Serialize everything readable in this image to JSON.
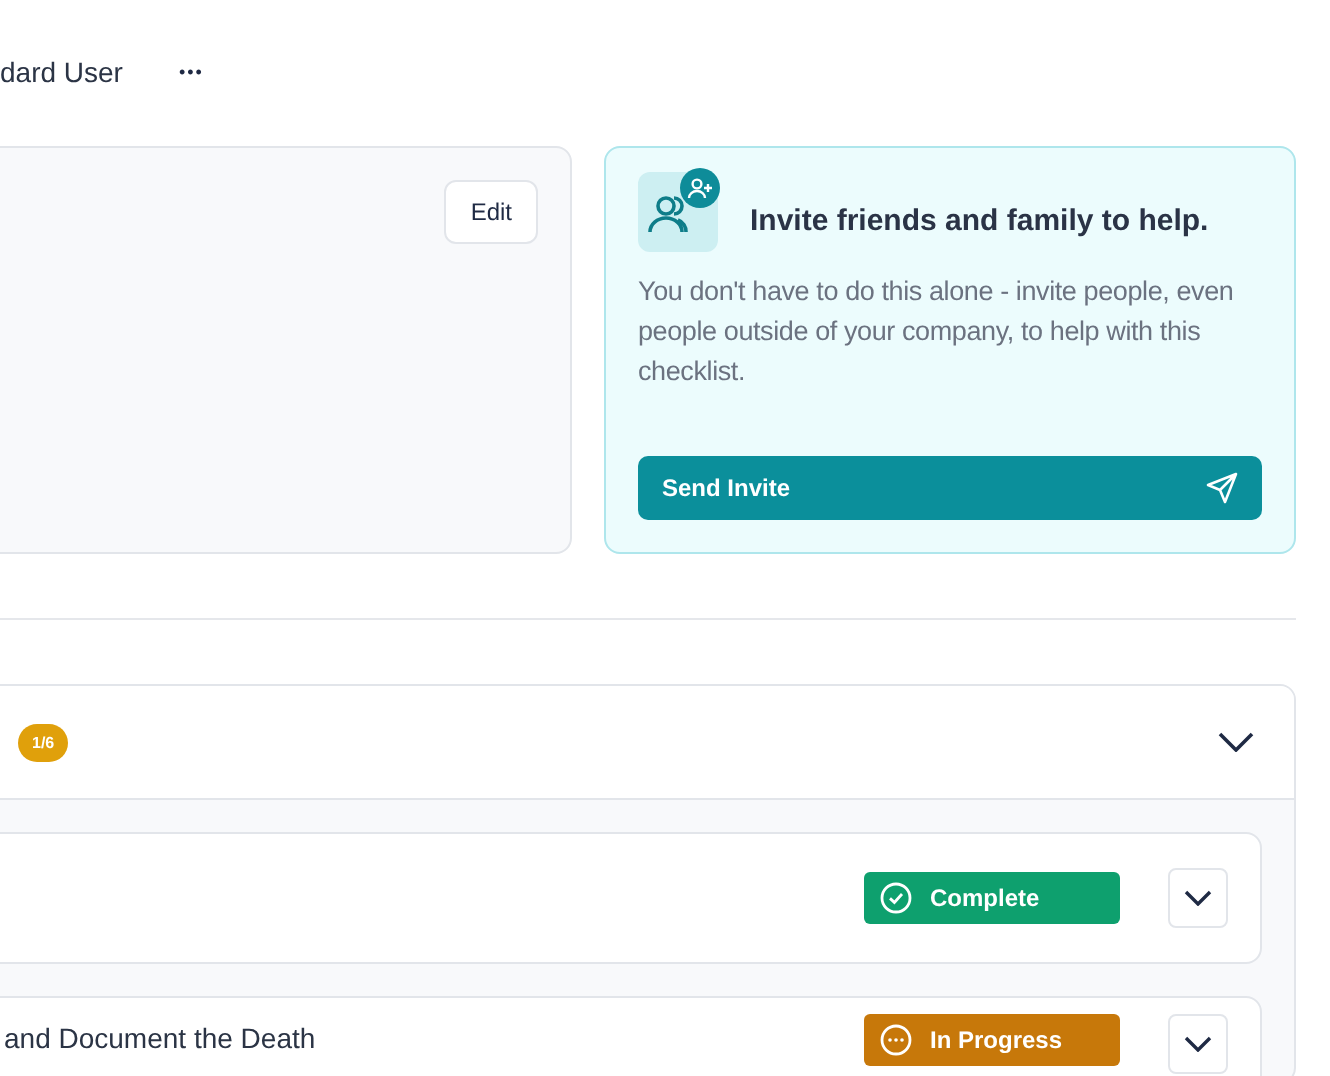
{
  "header": {
    "user_label": "dard User",
    "menu_glyph": "•••"
  },
  "profile_card": {
    "edit_button": "Edit"
  },
  "invite_card": {
    "title": "Invite friends and family to help.",
    "body": "You don't have to do this alone - invite people, even people outside of your company, to help with this checklist.",
    "button": "Send Invite"
  },
  "section": {
    "progress_badge": "1/6",
    "expanded": true,
    "tasks": [
      {
        "status": "Complete",
        "kind": "complete"
      },
      {
        "title": "and Document the Death",
        "status": "In Progress",
        "kind": "in_progress"
      }
    ]
  }
}
